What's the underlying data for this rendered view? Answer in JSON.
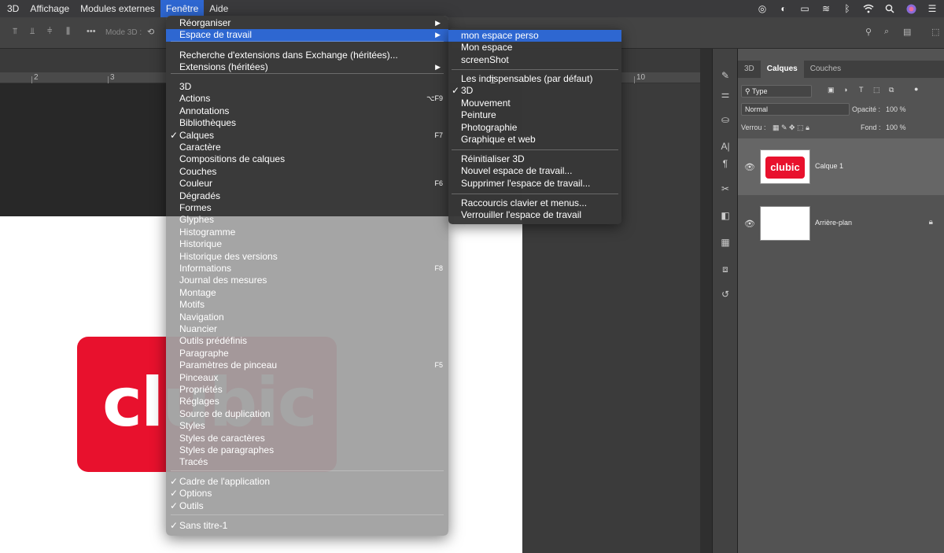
{
  "menubar": {
    "items": [
      "3D",
      "Affichage",
      "Modules externes",
      "Fenêtre",
      "Aide"
    ],
    "active": "Fenêtre"
  },
  "options_bar": {
    "mode3d_label": "Mode 3D :"
  },
  "ruler": {
    "ticks": [
      "2",
      "3",
      "10"
    ]
  },
  "document": {
    "logo_text": "clubic",
    "logo_color": "#e8112d"
  },
  "fenetre_menu": {
    "group1": [
      {
        "label": "Réorganiser",
        "submenu": true
      },
      {
        "label": "Espace de travail",
        "submenu": true,
        "highlighted": true
      }
    ],
    "group2": [
      {
        "label": "Recherche d'extensions dans Exchange (héritées)..."
      },
      {
        "label": "Extensions (héritées)",
        "submenu": true
      }
    ],
    "group3": [
      {
        "label": "3D"
      },
      {
        "label": "Actions",
        "shortcut": "⌥F9"
      },
      {
        "label": "Annotations"
      },
      {
        "label": "Bibliothèques"
      },
      {
        "label": "Calques",
        "checked": true,
        "shortcut": "F7"
      },
      {
        "label": "Caractère"
      },
      {
        "label": "Compositions de calques"
      },
      {
        "label": "Couches"
      },
      {
        "label": "Couleur",
        "shortcut": "F6"
      },
      {
        "label": "Dégradés"
      },
      {
        "label": "Formes"
      },
      {
        "label": "Glyphes"
      },
      {
        "label": "Histogramme"
      },
      {
        "label": "Historique"
      },
      {
        "label": "Historique des versions"
      },
      {
        "label": "Informations",
        "shortcut": "F8"
      },
      {
        "label": "Journal des mesures"
      },
      {
        "label": "Montage"
      },
      {
        "label": "Motifs"
      },
      {
        "label": "Navigation"
      },
      {
        "label": "Nuancier"
      },
      {
        "label": "Outils prédéfinis"
      },
      {
        "label": "Paragraphe"
      },
      {
        "label": "Paramètres de pinceau",
        "shortcut": "F5"
      },
      {
        "label": "Pinceaux"
      },
      {
        "label": "Propriétés"
      },
      {
        "label": "Réglages"
      },
      {
        "label": "Source de duplication"
      },
      {
        "label": "Styles"
      },
      {
        "label": "Styles de caractères"
      },
      {
        "label": "Styles de paragraphes"
      },
      {
        "label": "Tracés"
      }
    ],
    "group4": [
      {
        "label": "Cadre de l'application",
        "checked": true
      },
      {
        "label": "Options",
        "checked": true
      },
      {
        "label": "Outils",
        "checked": true
      }
    ],
    "group5": [
      {
        "label": "Sans titre-1",
        "checked": true
      }
    ]
  },
  "workspace_submenu": {
    "group1": [
      {
        "label": "mon espace perso",
        "highlighted": true
      },
      {
        "label": "Mon espace"
      },
      {
        "label": "screenShot"
      }
    ],
    "group2": [
      {
        "label": "Les indispensables (par défaut)"
      },
      {
        "label": "3D",
        "checked": true
      },
      {
        "label": "Mouvement"
      },
      {
        "label": "Peinture"
      },
      {
        "label": "Photographie"
      },
      {
        "label": "Graphique et web"
      }
    ],
    "group3": [
      {
        "label": "Réinitialiser 3D"
      },
      {
        "label": "Nouvel espace de travail..."
      },
      {
        "label": "Supprimer l'espace de travail..."
      }
    ],
    "group4": [
      {
        "label": "Raccourcis clavier et menus..."
      },
      {
        "label": "Verrouiller l'espace de travail"
      }
    ]
  },
  "layers_panel": {
    "tabs": [
      "3D",
      "Calques",
      "Couches"
    ],
    "active_tab": "Calques",
    "filter_kind": "Type",
    "blend_mode": "Normal",
    "opacity_label": "Opacité :",
    "opacity_value": "100 %",
    "lock_label": "Verrou :",
    "fill_label": "Fond :",
    "fill_value": "100 %",
    "layers": [
      {
        "name": "Calque 1",
        "selected": true,
        "thumb_text": "clubic"
      },
      {
        "name": "Arrière-plan",
        "locked": true
      }
    ]
  }
}
